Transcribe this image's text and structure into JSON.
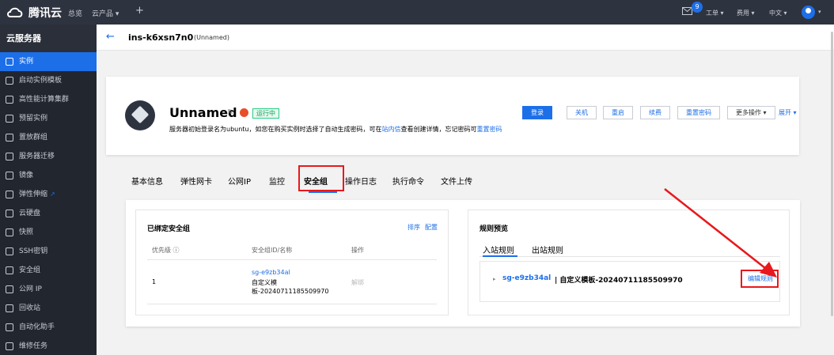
{
  "topbar": {
    "brand": "腾讯云",
    "nav": [
      "总览",
      "云产品 ▾",
      "+"
    ],
    "notification_count": "9",
    "menus": [
      "工单 ▾",
      "费用 ▾",
      "中文 ▾"
    ]
  },
  "sidebar": {
    "title": "云服务器",
    "items": [
      {
        "label": "实例",
        "icon": "cube-icon"
      },
      {
        "label": "启动实例模板",
        "icon": "template-icon"
      },
      {
        "label": "高性能计算集群",
        "icon": "cluster-icon"
      },
      {
        "label": "预留实例",
        "icon": "reserve-icon"
      },
      {
        "label": "置放群组",
        "icon": "group-icon"
      },
      {
        "label": "服务器迁移",
        "icon": "migrate-icon"
      },
      {
        "label": "镜像",
        "icon": "image-icon"
      },
      {
        "label": "弹性伸缩",
        "icon": "scaling-icon",
        "ext": "↗"
      },
      {
        "label": "云硬盘",
        "icon": "disk-icon"
      },
      {
        "label": "快照",
        "icon": "camera-icon"
      },
      {
        "label": "SSH密钥",
        "icon": "key-icon"
      },
      {
        "label": "安全组",
        "icon": "shield-icon"
      },
      {
        "label": "公网 IP",
        "icon": "ip-icon"
      },
      {
        "label": "回收站",
        "icon": "recycle-icon"
      },
      {
        "label": "自动化助手",
        "icon": "robot-icon"
      },
      {
        "label": "维修任务",
        "icon": "wrench-icon"
      }
    ]
  },
  "header": {
    "instance_id": "ins-k6xsn7n0",
    "instance_sub": "(Unnamed)"
  },
  "summary": {
    "name": "Unnamed",
    "status": "运行中",
    "desc_pre": "服务器初始登录名为ubuntu，如您在购买实例时选择了自动生成密码，可在",
    "desc_link1": "站内信",
    "desc_mid": "查看创建详情，忘记密码可",
    "desc_link2": "重置密码",
    "buttons": [
      "登录",
      "关机",
      "重启",
      "续费",
      "重置密码",
      "更多操作 ▾"
    ],
    "expand": "展开 ▾"
  },
  "tabs": [
    "基本信息",
    "弹性网卡",
    "公网IP",
    "监控",
    "安全组",
    "操作日志",
    "执行命令",
    "文件上传"
  ],
  "bound_sg": {
    "title": "已绑定安全组",
    "actions": [
      "排序",
      "配置"
    ],
    "columns": [
      "优先级 ⓘ",
      "安全组ID/名称",
      "操作"
    ],
    "row": {
      "priority": "1",
      "sg_id": "sg-e9zb34al",
      "sg_name_line1": "自定义模",
      "sg_name_line2": "板-20240711185509970",
      "action": "解绑"
    }
  },
  "preview": {
    "title": "规则预览",
    "tabs": [
      "入站规则",
      "出站规则"
    ],
    "rule_id": "sg-e9zb34al",
    "rule_name": " | 自定义模板-20240711185509970",
    "edit": "编辑规则"
  },
  "colors": {
    "accent": "#1d6fe8",
    "highlight": "#e8181d",
    "status": "#0aa45d"
  }
}
